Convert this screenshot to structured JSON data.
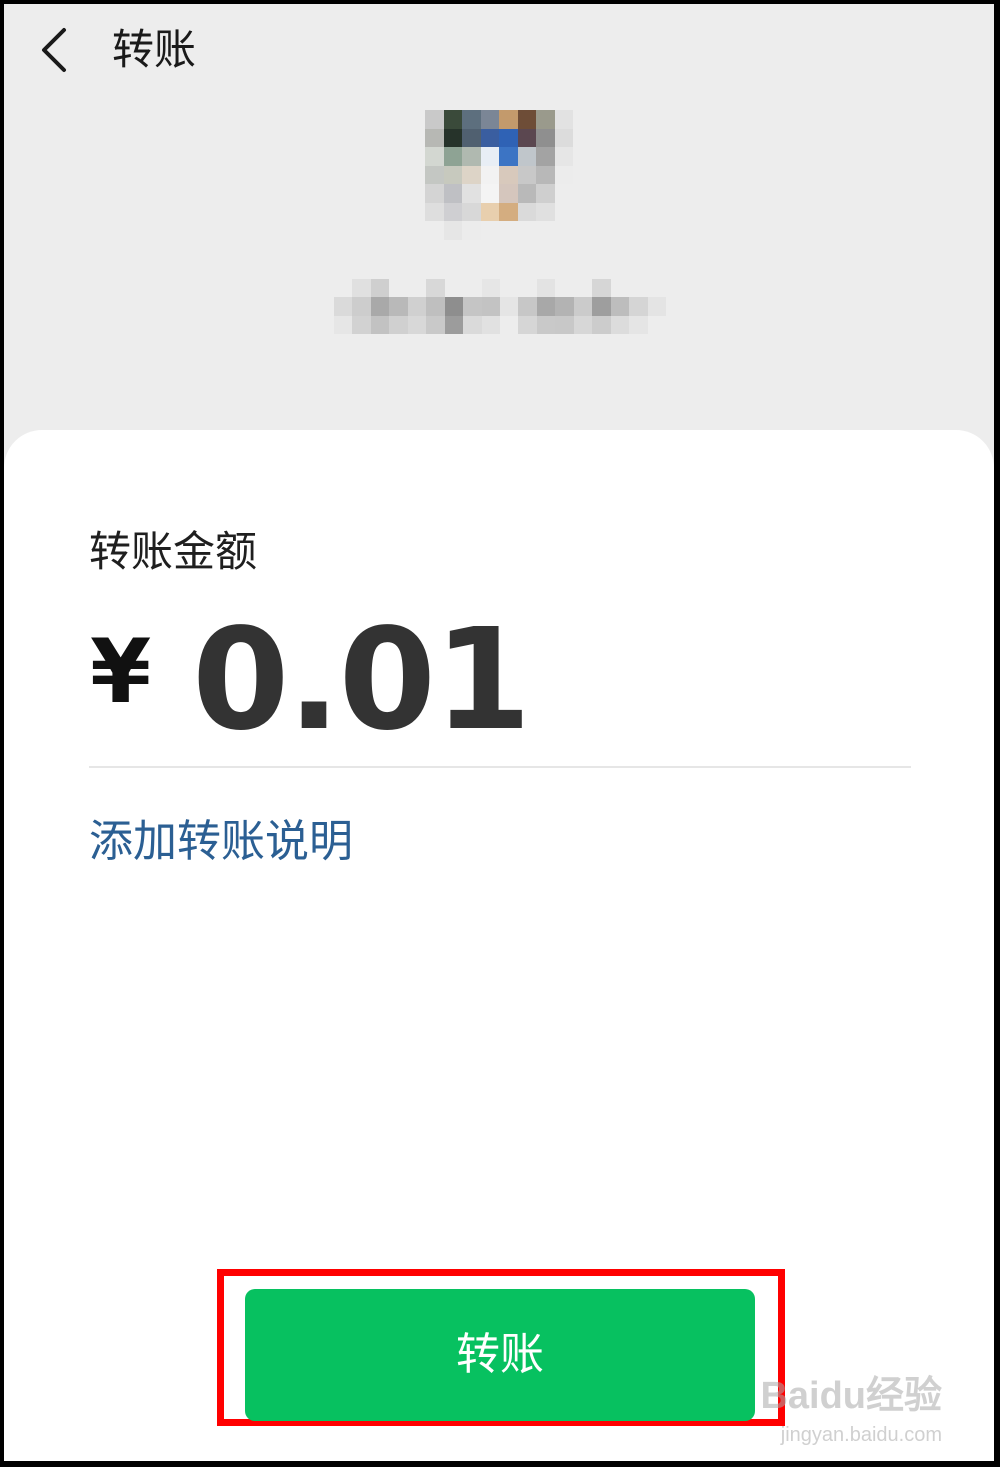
{
  "nav": {
    "title": "转账",
    "back_icon": "chevron-left-icon"
  },
  "recipient": {
    "avatar": "pixelated-avatar",
    "name": "pixelated-name"
  },
  "amount": {
    "label": "转账金额",
    "currency_symbol": "¥",
    "value": "0.01"
  },
  "note": {
    "link_label": "添加转账说明"
  },
  "action": {
    "transfer_label": "转账"
  },
  "watermark": {
    "brand": "Baidu经验",
    "url": "jingyan.baidu.com"
  },
  "colors": {
    "accent_green": "#07c160",
    "link_blue": "#2b5f93",
    "highlight_red": "#ff0000",
    "header_bg": "#ededed"
  }
}
